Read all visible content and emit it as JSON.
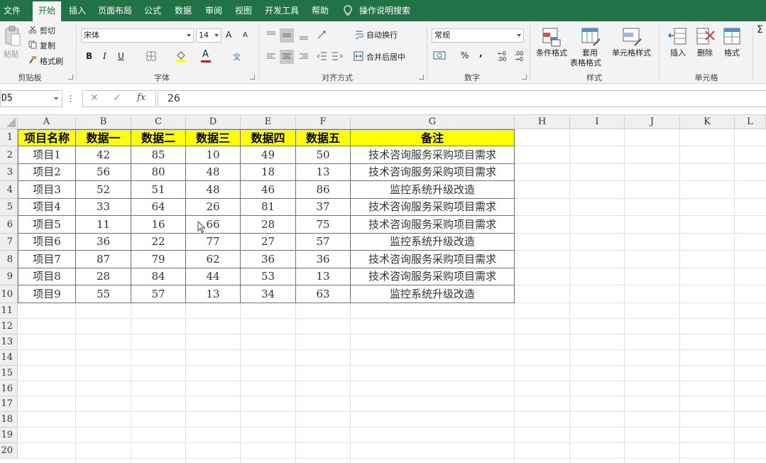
{
  "menu": {
    "tabs": [
      "文件",
      "开始",
      "插入",
      "页面布局",
      "公式",
      "数据",
      "审阅",
      "视图",
      "开发工具",
      "帮助"
    ],
    "active": "开始",
    "tell_me": "操作说明搜索"
  },
  "ribbon": {
    "clipboard": {
      "paste": "粘贴",
      "cut": "剪切",
      "copy": "复制",
      "format_painter": "格式刷",
      "label": "剪贴板"
    },
    "font": {
      "name": "宋体",
      "size": "14",
      "bold": "B",
      "italic": "I",
      "underline": "U",
      "grow": "A",
      "shrink": "A",
      "font_color_letter": "A",
      "phonetic": "文",
      "label": "字体"
    },
    "alignment": {
      "wrap": "自动换行",
      "merge": "合并后居中",
      "label": "对齐方式"
    },
    "number": {
      "format": "常规",
      "percent": "%",
      "comma": ",",
      "inc_decimal": "←0 .00",
      "dec_decimal": ".00 →0",
      "label": "数字"
    },
    "styles": {
      "conditional": "条件格式",
      "table_format_1": "套用",
      "table_format_2": "表格格式",
      "cell_styles": "单元格样式",
      "label": "样式"
    },
    "cells": {
      "insert": "插入",
      "delete": "删除",
      "format": "格式",
      "label": "单元格"
    },
    "accent": "#217346",
    "fill_color": "#ffff00",
    "font_color": "#ff0000"
  },
  "formula_bar": {
    "name_box": "D5",
    "cancel": "✕",
    "enter": "✓",
    "fx": "fx",
    "content": "26"
  },
  "sheet": {
    "columns": [
      "A",
      "B",
      "C",
      "D",
      "E",
      "F",
      "G",
      "H",
      "I",
      "J",
      "K",
      "L"
    ],
    "row_numbers": [
      "1",
      "2",
      "3",
      "4",
      "5",
      "6",
      "7",
      "8",
      "9",
      "10",
      "11",
      "12",
      "13",
      "14",
      "15",
      "16",
      "17",
      "18",
      "19",
      "20"
    ],
    "header_fill": "#ffff00",
    "headers": [
      "项目名称",
      "数据一",
      "数据二",
      "数据三",
      "数据四",
      "数据五",
      "备注"
    ],
    "rows": [
      [
        "项目1",
        "42",
        "85",
        "10",
        "49",
        "50",
        "技术咨询服务采购项目需求"
      ],
      [
        "项目2",
        "56",
        "80",
        "48",
        "18",
        "13",
        "技术咨询服务采购项目需求"
      ],
      [
        "项目3",
        "52",
        "51",
        "48",
        "46",
        "86",
        "监控系统升级改造"
      ],
      [
        "项目4",
        "33",
        "64",
        "26",
        "81",
        "37",
        "技术咨询服务采购项目需求"
      ],
      [
        "项目5",
        "11",
        "16",
        "66",
        "28",
        "75",
        "技术咨询服务采购项目需求"
      ],
      [
        "项目6",
        "36",
        "22",
        "77",
        "27",
        "57",
        "监控系统升级改造"
      ],
      [
        "项目7",
        "87",
        "79",
        "62",
        "36",
        "36",
        "技术咨询服务采购项目需求"
      ],
      [
        "项目8",
        "28",
        "84",
        "44",
        "53",
        "13",
        "技术咨询服务采购项目需求"
      ],
      [
        "项目9",
        "55",
        "57",
        "13",
        "34",
        "63",
        "监控系统升级改造"
      ]
    ]
  }
}
